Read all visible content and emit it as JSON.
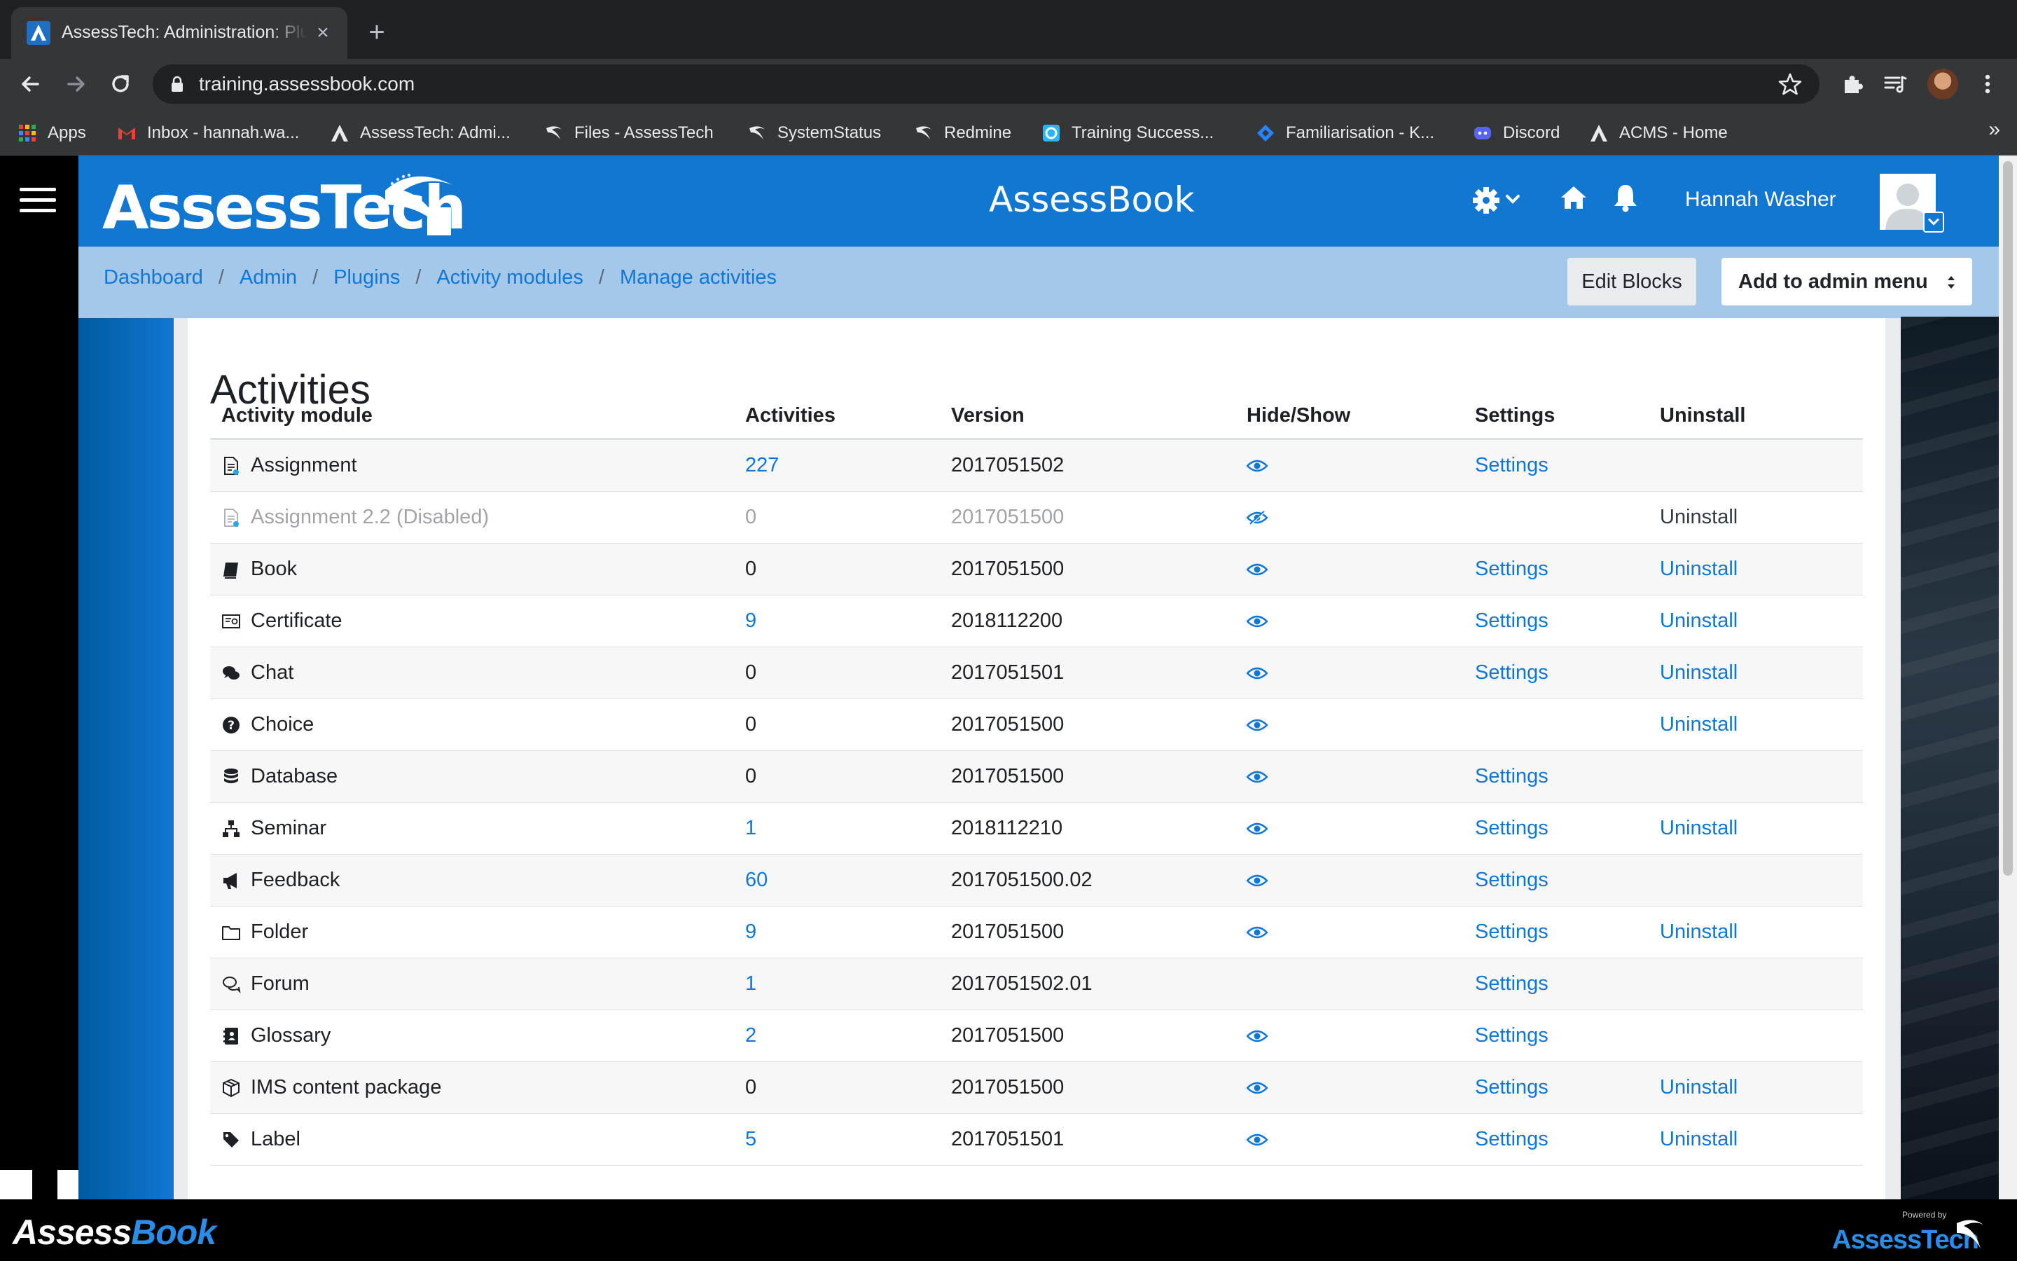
{
  "browser": {
    "tab_title": "AssessTech: Administration: Plugins: Activity modules: Manage activities",
    "url": "training.assessbook.com",
    "bookmarks": [
      {
        "label": "Apps",
        "icon": "apps-grid-icon"
      },
      {
        "label": "Inbox - hannah.wa...",
        "icon": "gmail-icon"
      },
      {
        "label": "AssessTech: Admi...",
        "icon": "assesstech-icon"
      },
      {
        "label": "Files - AssessTech",
        "icon": "assesstech-swoosh-icon"
      },
      {
        "label": "SystemStatus",
        "icon": "assesstech-swoosh-icon"
      },
      {
        "label": "Redmine",
        "icon": "assesstech-swoosh-icon"
      },
      {
        "label": "Training Success...",
        "icon": "training-icon"
      },
      {
        "label": "Familiarisation - K...",
        "icon": "jira-icon"
      },
      {
        "label": "Discord",
        "icon": "discord-icon"
      },
      {
        "label": "ACMS - Home",
        "icon": "assesstech-icon"
      }
    ],
    "bookmarks_more": "»"
  },
  "header": {
    "logo_text": "AssessTech",
    "app_name": "AssessBook",
    "user_name": "Hannah Washer"
  },
  "breadcrumb": [
    "Dashboard",
    "Admin",
    "Plugins",
    "Activity modules",
    "Manage activities"
  ],
  "breadcrumb_sep": "/",
  "buttons": {
    "edit_blocks": "Edit Blocks",
    "admin_menu": "Add to admin menu"
  },
  "page_title": "Activities",
  "table": {
    "headers": [
      "Activity module",
      "Activities",
      "Version",
      "Hide/Show",
      "Settings",
      "Uninstall"
    ],
    "rows": [
      {
        "name": "Assignment",
        "icon": "assignment-icon",
        "count": "227",
        "count_link": true,
        "version": "2017051502",
        "visible": true,
        "settings": "Settings",
        "uninstall": "",
        "disabled": false
      },
      {
        "name": "Assignment 2.2 (Disabled)",
        "icon": "assignment-icon",
        "count": "0",
        "count_link": false,
        "version": "2017051500",
        "visible": false,
        "settings": "",
        "uninstall": "Uninstall",
        "disabled": true
      },
      {
        "name": "Book",
        "icon": "book-icon",
        "count": "0",
        "count_link": false,
        "version": "2017051500",
        "visible": true,
        "settings": "Settings",
        "uninstall": "Uninstall",
        "disabled": false
      },
      {
        "name": "Certificate",
        "icon": "certificate-icon",
        "count": "9",
        "count_link": true,
        "version": "2018112200",
        "visible": true,
        "settings": "Settings",
        "uninstall": "Uninstall",
        "disabled": false
      },
      {
        "name": "Chat",
        "icon": "chat-icon",
        "count": "0",
        "count_link": false,
        "version": "2017051501",
        "visible": true,
        "settings": "Settings",
        "uninstall": "Uninstall",
        "disabled": false
      },
      {
        "name": "Choice",
        "icon": "question-icon",
        "count": "0",
        "count_link": false,
        "version": "2017051500",
        "visible": true,
        "settings": "",
        "uninstall": "Uninstall",
        "disabled": false
      },
      {
        "name": "Database",
        "icon": "database-icon",
        "count": "0",
        "count_link": false,
        "version": "2017051500",
        "visible": true,
        "settings": "Settings",
        "uninstall": "",
        "disabled": false
      },
      {
        "name": "Seminar",
        "icon": "sitemap-icon",
        "count": "1",
        "count_link": true,
        "version": "2018112210",
        "visible": true,
        "settings": "Settings",
        "uninstall": "Uninstall",
        "disabled": false
      },
      {
        "name": "Feedback",
        "icon": "megaphone-icon",
        "count": "60",
        "count_link": true,
        "version": "2017051500.02",
        "visible": true,
        "settings": "Settings",
        "uninstall": "",
        "disabled": false
      },
      {
        "name": "Folder",
        "icon": "folder-icon",
        "count": "9",
        "count_link": true,
        "version": "2017051500",
        "visible": true,
        "settings": "Settings",
        "uninstall": "Uninstall",
        "disabled": false
      },
      {
        "name": "Forum",
        "icon": "forum-icon",
        "count": "1",
        "count_link": true,
        "version": "2017051502.01",
        "visible": null,
        "settings": "Settings",
        "uninstall": "",
        "disabled": false
      },
      {
        "name": "Glossary",
        "icon": "glossary-icon",
        "count": "2",
        "count_link": true,
        "version": "2017051500",
        "visible": true,
        "settings": "Settings",
        "uninstall": "",
        "disabled": false
      },
      {
        "name": "IMS content package",
        "icon": "package-icon",
        "count": "0",
        "count_link": false,
        "version": "2017051500",
        "visible": true,
        "settings": "Settings",
        "uninstall": "Uninstall",
        "disabled": false
      },
      {
        "name": "Label",
        "icon": "tag-icon",
        "count": "5",
        "count_link": true,
        "version": "2017051501",
        "visible": true,
        "settings": "Settings",
        "uninstall": "Uninstall",
        "disabled": false
      }
    ]
  },
  "footer": {
    "logo_left_a": "Assess",
    "logo_left_b": "Book",
    "powered_by": "Powered by",
    "logo_right": "AssessTech"
  },
  "colors": {
    "brand_blue": "#1177d1",
    "crumb_bar": "#a5c8ea",
    "link": "#1177d1"
  }
}
